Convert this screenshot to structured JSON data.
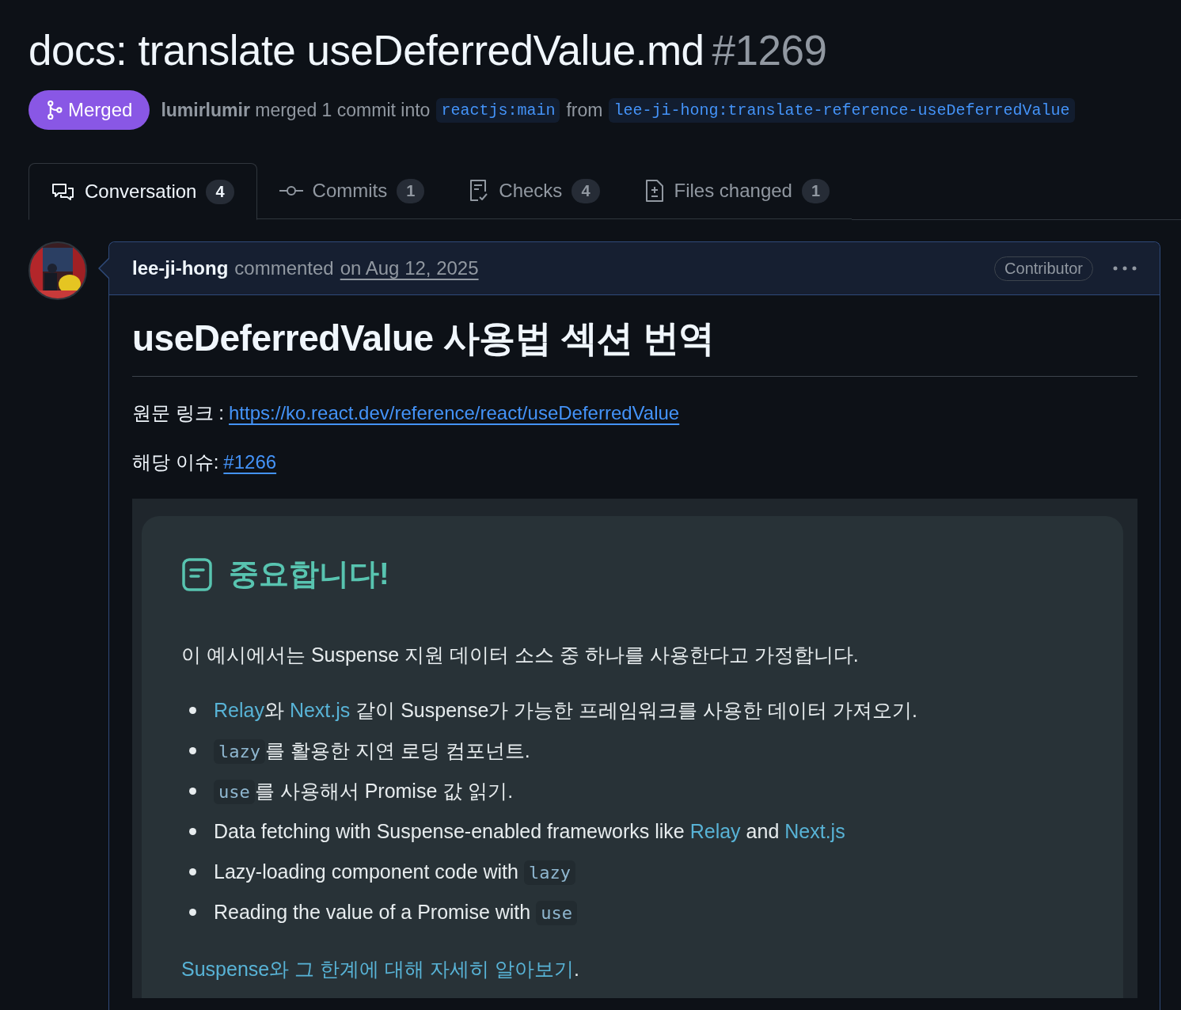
{
  "title": {
    "text": "docs: translate useDeferredValue.md",
    "number": "#1269"
  },
  "status": {
    "label": "Merged",
    "kind": "merged"
  },
  "merge_info": {
    "author": "lumirlumir",
    "text": "merged 1 commit into",
    "base": "reactjs:main",
    "from": "from",
    "head": "lee-ji-hong:translate-reference-useDeferredValue"
  },
  "tabs": [
    {
      "label": "Conversation",
      "count": "4",
      "kind": "conversation",
      "selected": true
    },
    {
      "label": "Commits",
      "count": "1",
      "kind": "commit",
      "selected": false
    },
    {
      "label": "Checks",
      "count": "4",
      "kind": "checks",
      "selected": false
    },
    {
      "label": "Files changed",
      "count": "1",
      "kind": "files",
      "selected": false
    }
  ],
  "comment": {
    "author": "lee-ji-hong",
    "action": "commented",
    "date": "on Aug 12, 2025",
    "badge": "Contributor",
    "heading": "useDeferredValue 사용법 섹션 번역",
    "paragraphs": [
      {
        "label": "원문 링크 :",
        "link": "https://ko.react.dev/reference/react/useDeferredValue"
      },
      {
        "label": "해당 이슈:",
        "link": "#1266"
      }
    ],
    "screenshot": {
      "title": "중요합니다!",
      "intro": "이 예시에서는 Suspense 지원 데이터 소스 중 하나를 사용한다고 가정합니다.",
      "items": [
        {
          "segments": [
            {
              "kind": "link",
              "text": "Relay"
            },
            {
              "kind": "text",
              "text": "와 "
            },
            {
              "kind": "link",
              "text": "Next.js"
            },
            {
              "kind": "text",
              "text": " 같이 Suspense가 가능한 프레임워크를 사용한 데이터 가져오기."
            }
          ]
        },
        {
          "segments": [
            {
              "kind": "code",
              "text": "lazy"
            },
            {
              "kind": "text",
              "text": "를 활용한 지연 로딩 컴포넌트."
            }
          ]
        },
        {
          "segments": [
            {
              "kind": "code",
              "text": "use"
            },
            {
              "kind": "text",
              "text": "를 사용해서 Promise 값 읽기."
            }
          ]
        },
        {
          "segments": [
            {
              "kind": "text",
              "text": "Data fetching with Suspense-enabled frameworks like "
            },
            {
              "kind": "link",
              "text": "Relay"
            },
            {
              "kind": "text",
              "text": " and "
            },
            {
              "kind": "link",
              "text": "Next.js"
            }
          ]
        },
        {
          "segments": [
            {
              "kind": "text",
              "text": "Lazy-loading component code with "
            },
            {
              "kind": "code",
              "text": "lazy"
            }
          ]
        },
        {
          "segments": [
            {
              "kind": "text",
              "text": "Reading the value of a Promise with "
            },
            {
              "kind": "code",
              "text": "use"
            }
          ]
        }
      ],
      "footer": [
        {
          "kind": "link",
          "text": "Suspense와 그 한계에 대해 자세히 알아보기"
        },
        {
          "kind": "text",
          "text": "."
        }
      ]
    }
  }
}
